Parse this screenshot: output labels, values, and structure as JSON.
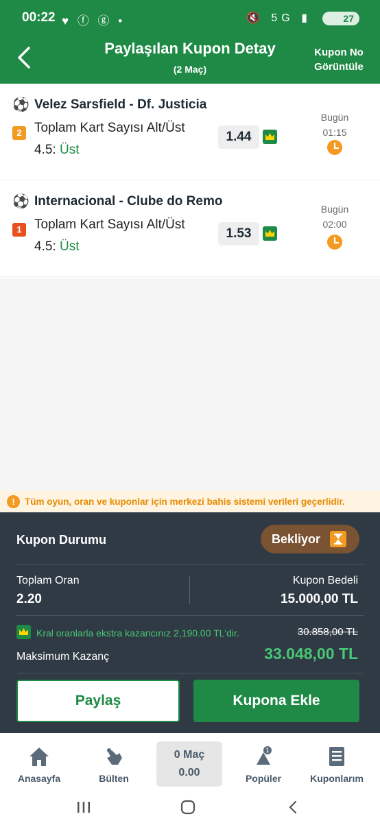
{
  "status_bar": {
    "time": "00:22",
    "left_icons": "♥ ⓕ ⓖ •",
    "right_icons": "🔇 5G ▮",
    "battery": "27"
  },
  "header": {
    "title": "Paylaşılan Kupon Detay",
    "subtitle": "(2 Maç)",
    "right_line1": "Kupon No",
    "right_line2": "Görüntüle"
  },
  "matches": [
    {
      "teams": "Velez Sarsfield - Df. Justicia",
      "seq": "2",
      "seq_color": "#f29a21",
      "market": "Toplam Kart Sayısı Alt/Üst",
      "pick_prefix": "4.5: ",
      "pick_value": "Üst",
      "odd": "1.44",
      "day": "Bugün",
      "time": "01:15"
    },
    {
      "teams": "Internacional - Clube do Remo",
      "seq": "1",
      "seq_color": "#e8501e",
      "market": "Toplam Kart Sayısı Alt/Üst",
      "pick_prefix": "4.5: ",
      "pick_value": "Üst",
      "odd": "1.53",
      "day": "Bugün",
      "time": "02:00"
    }
  ],
  "notice": "Tüm oyun, oran ve kuponlar için merkezi bahis sistemi verileri geçerlidir.",
  "coupon": {
    "status_label": "Kupon Durumu",
    "status_value": "Bekliyor",
    "total_odds_label": "Toplam Oran",
    "total_odds_value": "2.20",
    "stake_label": "Kupon Bedeli",
    "stake_value": "15.000,00 TL",
    "king_text": "Kral oranlarla ekstra kazancınız 2,190.00 TL'dir.",
    "old_win": "30.858,00 TL",
    "max_win_label": "Maksimum Kazanç",
    "max_win_value": "33.048,00 TL",
    "share_button": "Paylaş",
    "add_button": "Kupona Ekle"
  },
  "nav": {
    "home": "Anasayfa",
    "bulletin": "Bülten",
    "mac_count": "0 Maç",
    "mac_total": "0.00",
    "popular": "Popüler",
    "coupons": "Kuponlarım"
  },
  "colors": {
    "brand_green": "#1e8a45",
    "panel_dark": "#2f3a44",
    "accent_orange": "#f29a21",
    "win_green": "#48c774"
  }
}
